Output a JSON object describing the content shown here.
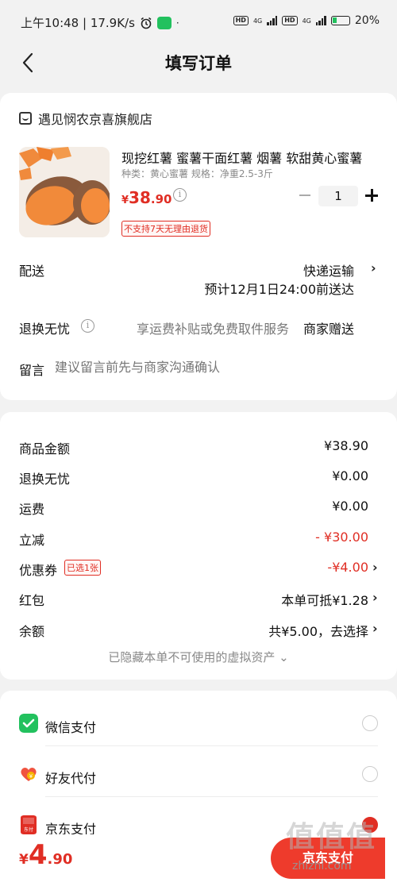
{
  "status_bar": {
    "time_speed": "上午10:48 | 17.9K/s",
    "dot": "·",
    "hd1": "HD",
    "hd2": "HD",
    "net1": "4G",
    "net2": "4G",
    "battery": "20%"
  },
  "nav": {
    "title": "填写订单"
  },
  "store": {
    "name": "遇见悯农京喜旗舰店"
  },
  "product": {
    "name": "现挖红薯 蜜薯干面红薯 烟薯 软甜黄心蜜薯",
    "spec": "种类：黄心蜜薯   规格：净重2.5-3斤",
    "price_symbol": "¥",
    "price_int": "38",
    "price_dec": ".90",
    "info": "i",
    "quantity": "1",
    "return_tag": "不支持7天无理由退货"
  },
  "shipping": {
    "label": "配送",
    "method": "快递运输",
    "eta": "预计12月1日24:00前送达"
  },
  "return_service": {
    "label": "退换无忧",
    "info": "i",
    "description": "享运费补贴或免费取件服务",
    "gift": "商家赠送"
  },
  "note": {
    "label": "留言",
    "placeholder": "建议留言前先与商家沟通确认"
  },
  "summary": {
    "rows": [
      {
        "label": "商品金额",
        "value": "¥38.90"
      },
      {
        "label": "退换无忧",
        "value": "¥0.00"
      },
      {
        "label": "运费",
        "value": "¥0.00"
      },
      {
        "label": "立减",
        "value": "- ¥30.00"
      },
      {
        "label": "优惠券",
        "value": "-¥4.00"
      },
      {
        "label": "红包",
        "value": "本单可抵¥1.28"
      },
      {
        "label": "余额",
        "value": "共¥5.00，去选择"
      }
    ],
    "coupon_tag": "已选1张",
    "hidden_assets": "已隐藏本单不可使用的虚拟资产 ⌄",
    "chevron": "›",
    "colors": {
      "accent_red": "#e02e24"
    }
  },
  "payment": {
    "options": [
      {
        "label": "微信支付",
        "icon": "wechat-pay-icon"
      },
      {
        "label": "好友代付",
        "icon": "friend-pay-icon"
      },
      {
        "label": "京东支付",
        "icon": "jd-pay-icon",
        "icon_text": "东付"
      }
    ]
  },
  "bottom": {
    "total_symbol": "¥",
    "total_int": "4",
    "total_dec": ".90",
    "submit_label": "京东支付",
    "watermark": "值值值",
    "watermark_sub": "zhizhi.com"
  },
  "misc": {
    "chevron": "›"
  }
}
